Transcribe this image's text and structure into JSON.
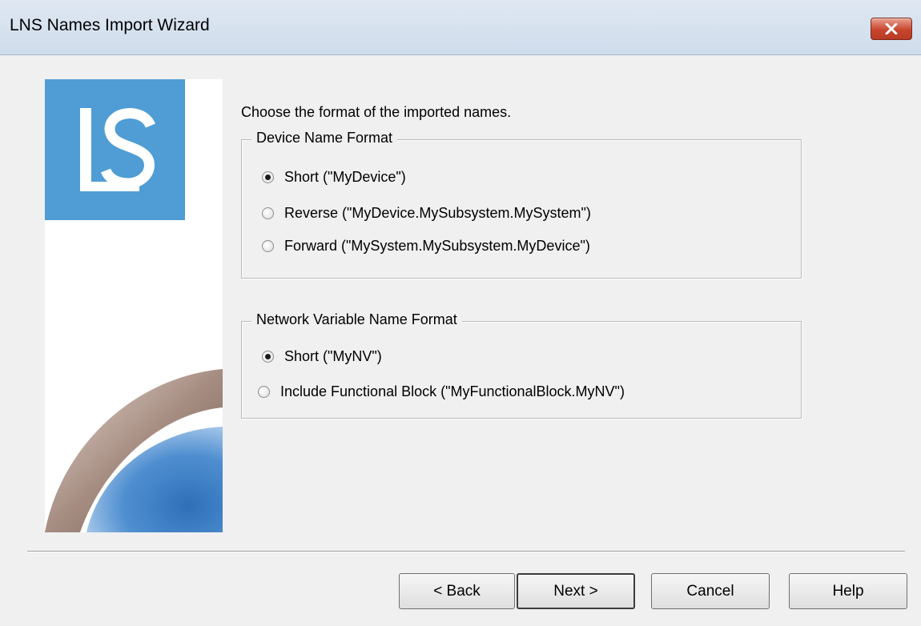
{
  "window": {
    "title": "LNS Names Import Wizard"
  },
  "icons": {
    "close": "close-icon",
    "logo": "ls-logo",
    "banner_art": "eye-banner-art"
  },
  "colors": {
    "logo_blue": "#4f9dd4",
    "close_red": "#c9452d"
  },
  "main": {
    "instruction": "Choose the format of the imported names."
  },
  "device_group": {
    "legend": "Device Name Format",
    "options": [
      {
        "label": "Short (\"MyDevice\")",
        "checked": true
      },
      {
        "label": "Reverse (\"MyDevice.MySubsystem.MySystem\")",
        "checked": false
      },
      {
        "label": "Forward (\"MySystem.MySubsystem.MyDevice\")",
        "checked": false
      }
    ]
  },
  "nv_group": {
    "legend": "Network Variable Name Format",
    "options": [
      {
        "label": "Short (\"MyNV\")",
        "checked": true
      },
      {
        "label": "Include Functional Block (\"MyFunctionalBlock.MyNV\")",
        "checked": false
      }
    ]
  },
  "buttons": {
    "back": "< Back",
    "next": "Next >",
    "cancel": "Cancel",
    "help": "Help"
  }
}
